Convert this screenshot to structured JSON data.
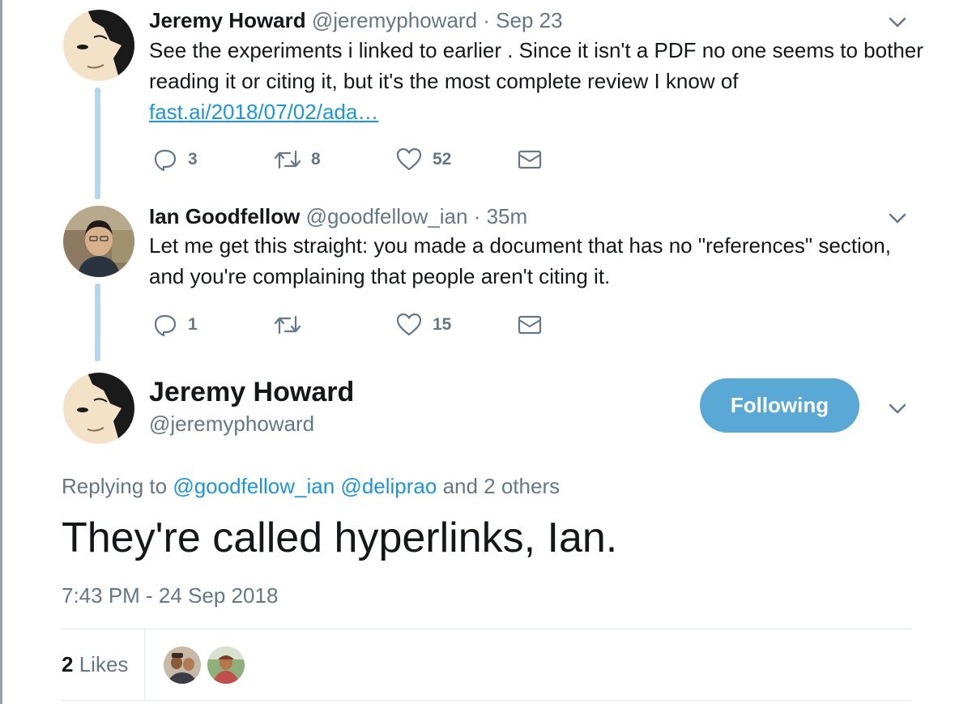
{
  "thread": [
    {
      "name": "Jeremy Howard",
      "handle": "@jeremyphoward",
      "separator": " · ",
      "time": "Sep 23",
      "text": "See the experiments i linked to earlier . Since it isn't a PDF no one seems to bother reading it or citing it, but it's the most complete review I know of",
      "link": "fast.ai/2018/07/02/ada…",
      "replies": "3",
      "retweets": "8",
      "likes": "52"
    },
    {
      "name": "Ian Goodfellow",
      "handle": "@goodfellow_ian",
      "separator": " · ",
      "time": "35m",
      "text": "Let me get this straight: you made a document that has no \"references\" section, and you're complaining that people aren't citing it.",
      "replies": "1",
      "retweets": "",
      "likes": "15"
    }
  ],
  "main_tweet": {
    "name": "Jeremy Howard",
    "handle": "@jeremyphoward",
    "follow_label": "Following",
    "replying_prefix": "Replying to",
    "replying_mention_1": "@goodfellow_ian",
    "replying_mention_2": "@deliprao",
    "replying_suffix": "and 2 others",
    "text": "They're called hyperlinks, Ian.",
    "timestamp": "7:43 PM - 24 Sep 2018",
    "likes_count": "2",
    "likes_label": "Likes"
  },
  "icons": {
    "reply": "reply-icon",
    "retweet": "retweet-icon",
    "like": "heart-icon",
    "dm": "envelope-icon",
    "menu": "chevron-down-icon"
  },
  "colors": {
    "text": "#14171a",
    "secondary": "#657786",
    "link": "#1b95e0",
    "thread_line": "#b3d7ec",
    "follow_button": "#5aa8d6",
    "divider": "#e1e8ed"
  }
}
